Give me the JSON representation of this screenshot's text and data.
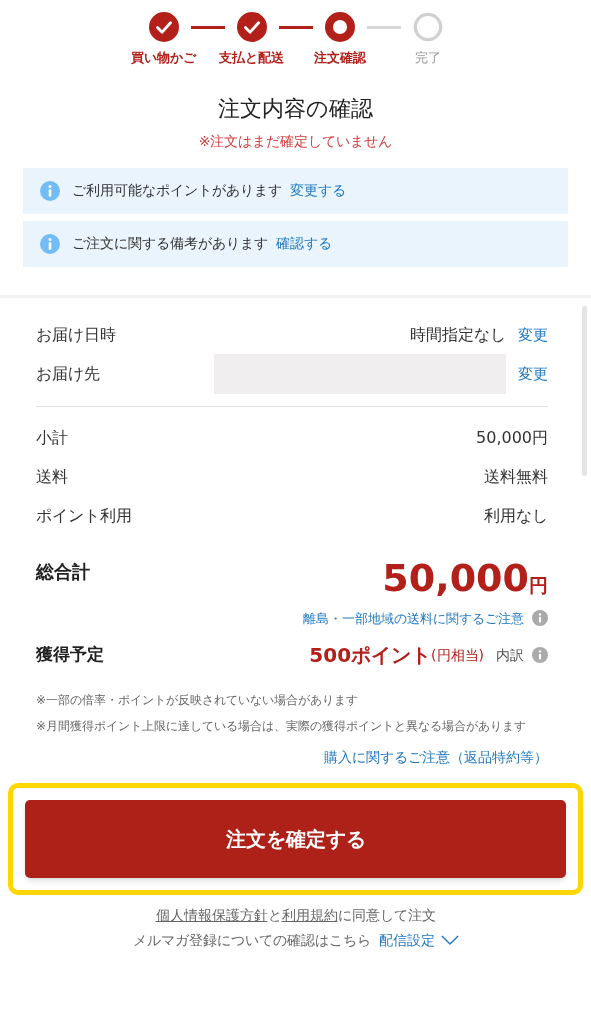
{
  "steps": [
    {
      "label": "買い物かご",
      "kind": "done"
    },
    {
      "label": "支払と配送",
      "kind": "done"
    },
    {
      "label": "注文確認",
      "kind": "current"
    },
    {
      "label": "完了",
      "kind": "pending"
    }
  ],
  "title": "注文内容の確認",
  "warning": "※注文はまだ確定していません",
  "notices": [
    {
      "text": "ご利用可能なポイントがあります",
      "link": "変更する"
    },
    {
      "text": "ご注文に関する備考があります",
      "link": "確認する"
    }
  ],
  "delivery": [
    {
      "label": "お届け日時",
      "value": "時間指定なし",
      "redacted": false,
      "link": "変更"
    },
    {
      "label": "お届け先",
      "redacted": true,
      "link": "変更"
    }
  ],
  "costs": [
    {
      "label": "小計",
      "value": "50,000円"
    },
    {
      "label": "送料",
      "value": "送料無料"
    },
    {
      "label": "ポイント利用",
      "value": "利用なし"
    }
  ],
  "total": {
    "label": "総合計",
    "amount": "50,000",
    "unit": "円",
    "note_link": "離島・一部地域の送料に関するご注意"
  },
  "points": {
    "label": "獲得予定",
    "amount": "500ポイント",
    "equivalent": "(円相当)",
    "breakdown": "内訳"
  },
  "notes": [
    "※一部の倍率・ポイントが反映されていない場合があります",
    "※月間獲得ポイント上限に達している場合は、実際の獲得ポイントと異なる場合があります"
  ],
  "purchase_link": "購入に関するご注意（返品特約等）",
  "confirm_button": {
    "label": "注文を確定する",
    "highlighted": true
  },
  "agreement": [
    {
      "text": "個人情報保護方針",
      "link": true
    },
    {
      "text": "と",
      "link": false
    },
    {
      "text": "利用規約",
      "link": true
    },
    {
      "text": "に同意して注文",
      "link": false
    }
  ],
  "newsletter": {
    "text": "メルマガ登録についての確認はこちら",
    "link": "配信設定"
  }
}
